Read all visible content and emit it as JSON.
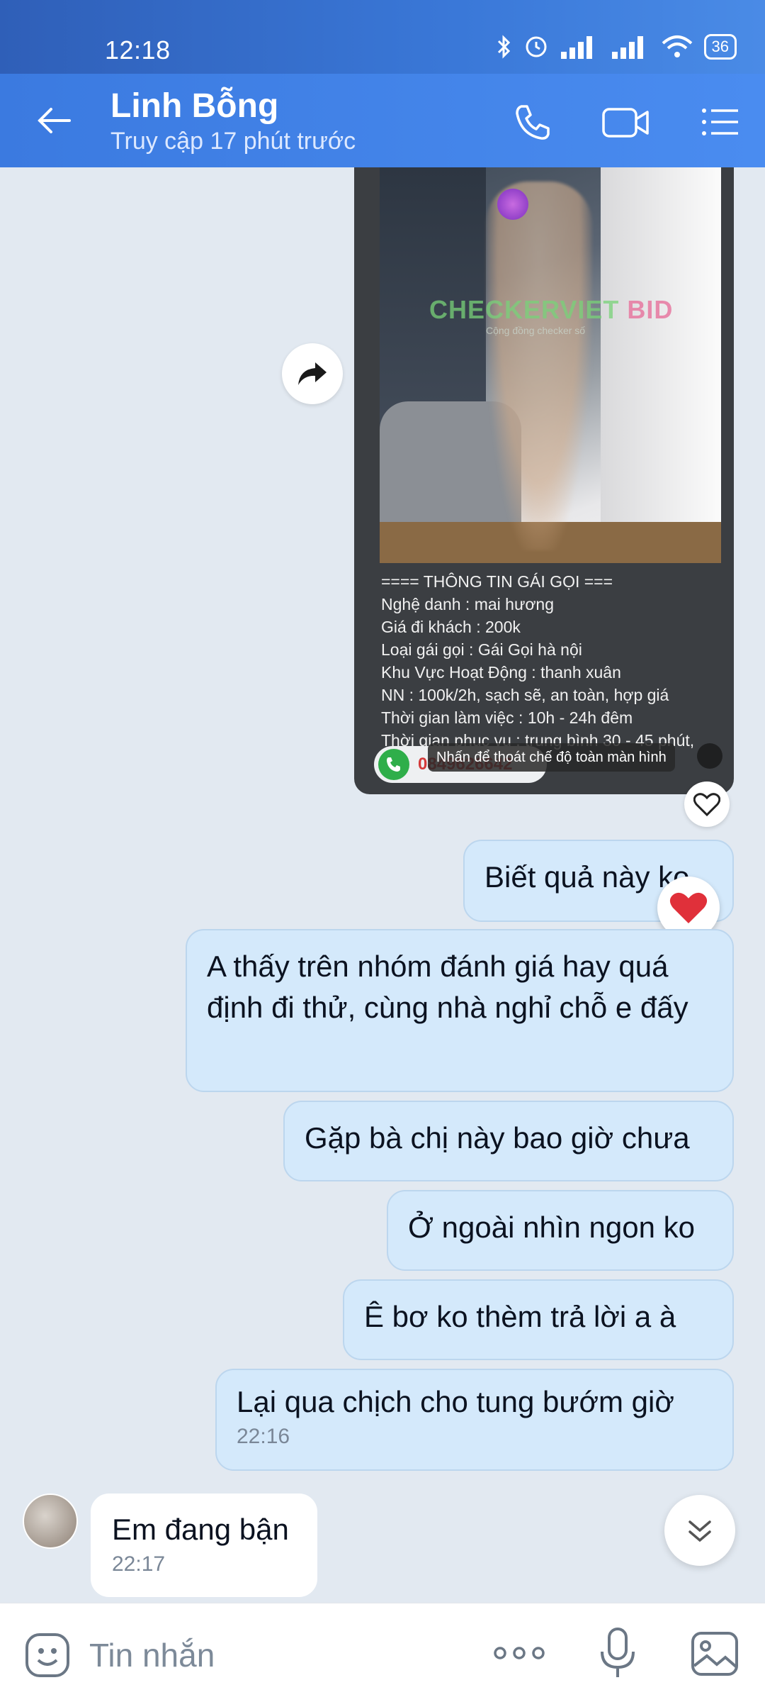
{
  "status_bar": {
    "time": "12:18",
    "battery": "36"
  },
  "header": {
    "title": "Linh Bỗng",
    "subtitle": "Truy cập 17 phút trước"
  },
  "image_message": {
    "watermark": "CHECKERVIET",
    "watermark_suffix": "BID",
    "watermark_sub": "Cộng đồng checker số",
    "info_lines": [
      "==== THÔNG TIN GÁI GỌI ===",
      "Nghệ danh : mai hương",
      "Giá đi khách : 200k",
      "Loại gái gọi : Gái Gọi hà nội",
      "Khu Vực Hoạt Động : thanh xuân",
      "NN : 100k/2h, sạch sẽ, an toàn, hợp giá",
      "Thời gian làm việc : 10h - 24h đêm",
      "Thời gian phục vụ : trung bình 30 - 45 phút,"
    ],
    "phone_partial": "0849626642",
    "tooltip": "Nhấn để thoát chế độ toàn màn hình"
  },
  "messages": [
    {
      "side": "right",
      "text": "Biết quả này ko"
    },
    {
      "side": "right",
      "text": "A thấy trên nhóm đánh giá hay quá định đi thử, cùng nhà nghỉ chỗ e đấy"
    },
    {
      "side": "right",
      "text": "Gặp bà chị này bao giờ chưa"
    },
    {
      "side": "right",
      "text": "Ở ngoài nhìn ngon ko"
    },
    {
      "side": "right",
      "text": "Ê bơ ko thèm trả lời a à"
    },
    {
      "side": "right",
      "text": "Lại qua chịch cho tung bướm giờ",
      "time": "22:16"
    },
    {
      "side": "left",
      "text": "Em đang bận",
      "time": "22:17"
    }
  ],
  "input": {
    "placeholder": "Tin nhắn"
  },
  "icons": {
    "back": "arrow-left-icon",
    "call": "phone-icon",
    "video": "video-icon",
    "menu": "menu-icon",
    "share": "share-icon",
    "heart": "heart-icon",
    "emoji": "emoji-icon",
    "more": "more-icon",
    "mic": "mic-icon",
    "gallery": "gallery-icon",
    "scroll": "chevron-down-icon"
  },
  "colors": {
    "accent": "#4a8cf0",
    "bubble_out": "#d4e9fb",
    "bubble_in": "#ffffff",
    "reaction_heart": "#e0303a"
  }
}
